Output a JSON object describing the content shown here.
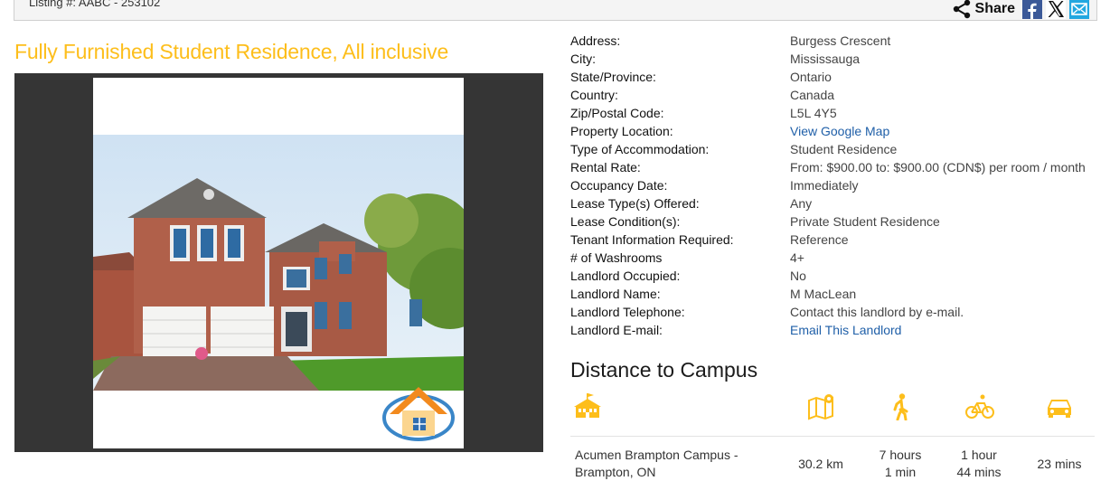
{
  "header": {
    "listing_number": "Listing #: AABC - 253102",
    "share_label": "Share",
    "share_buttons": [
      "facebook-icon",
      "x-icon",
      "email-icon"
    ]
  },
  "listing": {
    "title": "Fully Furnished Student Residence, All inclusive"
  },
  "details": [
    {
      "label": "Address:",
      "value": "Burgess Crescent"
    },
    {
      "label": "City:",
      "value": "Mississauga"
    },
    {
      "label": "State/Province:",
      "value": "Ontario"
    },
    {
      "label": "Country:",
      "value": "Canada"
    },
    {
      "label": "Zip/Postal Code:",
      "value": "L5L 4Y5"
    },
    {
      "label": "Property Location:",
      "value": "View Google Map"
    },
    {
      "label": "Type of Accommodation:",
      "value": "Student Residence"
    },
    {
      "label": "Rental Rate:",
      "value": "From: $900.00 to: $900.00 (CDN$) per room / month"
    },
    {
      "label": "Occupancy Date:",
      "value": "Immediately"
    },
    {
      "label": "Lease Type(s) Offered:",
      "value": "Any"
    },
    {
      "label": "Lease Condition(s):",
      "value": "Private Student Residence"
    },
    {
      "label": "Tenant Information Required:",
      "value": "Reference"
    },
    {
      "label": "# of Washrooms",
      "value": "4+"
    },
    {
      "label": "Landlord Occupied:",
      "value": "No"
    },
    {
      "label": "Landlord Name:",
      "value": "M MacLean"
    },
    {
      "label": "Landlord Telephone:",
      "value": "Contact this landlord by e-mail."
    },
    {
      "label": "Landlord E-mail:",
      "value": "Email This Landlord"
    }
  ],
  "distance": {
    "title": "Distance to Campus",
    "column_icons": [
      "campus-icon",
      "map-icon",
      "walking-icon",
      "bicycle-icon",
      "car-icon"
    ],
    "rows": [
      {
        "campus_line1": "Acumen Brampton Campus -",
        "campus_line2": "Brampton, ON",
        "distance": "30.2 km",
        "walk_line1": "7 hours",
        "walk_line2": "1 min",
        "bike_line1": "1 hour",
        "bike_line2": "44 mins",
        "car": "23 mins"
      }
    ]
  },
  "colors": {
    "accent": "#fdbe1b",
    "link": "#1f5fa8",
    "photo_frame": "#353535"
  }
}
